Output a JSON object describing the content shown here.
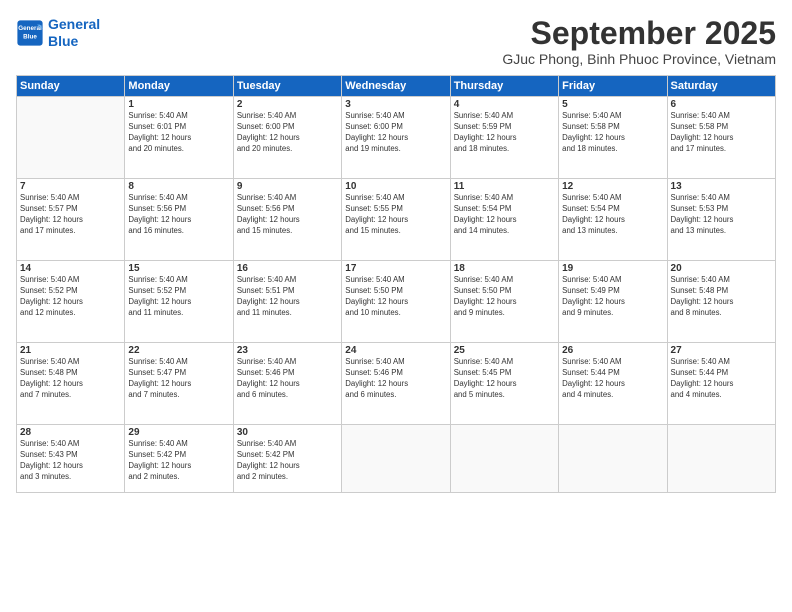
{
  "logo": {
    "line1": "General",
    "line2": "Blue"
  },
  "title": "September 2025",
  "subtitle": "GJuc Phong, Binh Phuoc Province, Vietnam",
  "days_header": [
    "Sunday",
    "Monday",
    "Tuesday",
    "Wednesday",
    "Thursday",
    "Friday",
    "Saturday"
  ],
  "weeks": [
    [
      {
        "day": "",
        "info": ""
      },
      {
        "day": "1",
        "info": "Sunrise: 5:40 AM\nSunset: 6:01 PM\nDaylight: 12 hours\nand 20 minutes."
      },
      {
        "day": "2",
        "info": "Sunrise: 5:40 AM\nSunset: 6:00 PM\nDaylight: 12 hours\nand 20 minutes."
      },
      {
        "day": "3",
        "info": "Sunrise: 5:40 AM\nSunset: 6:00 PM\nDaylight: 12 hours\nand 19 minutes."
      },
      {
        "day": "4",
        "info": "Sunrise: 5:40 AM\nSunset: 5:59 PM\nDaylight: 12 hours\nand 18 minutes."
      },
      {
        "day": "5",
        "info": "Sunrise: 5:40 AM\nSunset: 5:58 PM\nDaylight: 12 hours\nand 18 minutes."
      },
      {
        "day": "6",
        "info": "Sunrise: 5:40 AM\nSunset: 5:58 PM\nDaylight: 12 hours\nand 17 minutes."
      }
    ],
    [
      {
        "day": "7",
        "info": "Sunrise: 5:40 AM\nSunset: 5:57 PM\nDaylight: 12 hours\nand 17 minutes."
      },
      {
        "day": "8",
        "info": "Sunrise: 5:40 AM\nSunset: 5:56 PM\nDaylight: 12 hours\nand 16 minutes."
      },
      {
        "day": "9",
        "info": "Sunrise: 5:40 AM\nSunset: 5:56 PM\nDaylight: 12 hours\nand 15 minutes."
      },
      {
        "day": "10",
        "info": "Sunrise: 5:40 AM\nSunset: 5:55 PM\nDaylight: 12 hours\nand 15 minutes."
      },
      {
        "day": "11",
        "info": "Sunrise: 5:40 AM\nSunset: 5:54 PM\nDaylight: 12 hours\nand 14 minutes."
      },
      {
        "day": "12",
        "info": "Sunrise: 5:40 AM\nSunset: 5:54 PM\nDaylight: 12 hours\nand 13 minutes."
      },
      {
        "day": "13",
        "info": "Sunrise: 5:40 AM\nSunset: 5:53 PM\nDaylight: 12 hours\nand 13 minutes."
      }
    ],
    [
      {
        "day": "14",
        "info": "Sunrise: 5:40 AM\nSunset: 5:52 PM\nDaylight: 12 hours\nand 12 minutes."
      },
      {
        "day": "15",
        "info": "Sunrise: 5:40 AM\nSunset: 5:52 PM\nDaylight: 12 hours\nand 11 minutes."
      },
      {
        "day": "16",
        "info": "Sunrise: 5:40 AM\nSunset: 5:51 PM\nDaylight: 12 hours\nand 11 minutes."
      },
      {
        "day": "17",
        "info": "Sunrise: 5:40 AM\nSunset: 5:50 PM\nDaylight: 12 hours\nand 10 minutes."
      },
      {
        "day": "18",
        "info": "Sunrise: 5:40 AM\nSunset: 5:50 PM\nDaylight: 12 hours\nand 9 minutes."
      },
      {
        "day": "19",
        "info": "Sunrise: 5:40 AM\nSunset: 5:49 PM\nDaylight: 12 hours\nand 9 minutes."
      },
      {
        "day": "20",
        "info": "Sunrise: 5:40 AM\nSunset: 5:48 PM\nDaylight: 12 hours\nand 8 minutes."
      }
    ],
    [
      {
        "day": "21",
        "info": "Sunrise: 5:40 AM\nSunset: 5:48 PM\nDaylight: 12 hours\nand 7 minutes."
      },
      {
        "day": "22",
        "info": "Sunrise: 5:40 AM\nSunset: 5:47 PM\nDaylight: 12 hours\nand 7 minutes."
      },
      {
        "day": "23",
        "info": "Sunrise: 5:40 AM\nSunset: 5:46 PM\nDaylight: 12 hours\nand 6 minutes."
      },
      {
        "day": "24",
        "info": "Sunrise: 5:40 AM\nSunset: 5:46 PM\nDaylight: 12 hours\nand 6 minutes."
      },
      {
        "day": "25",
        "info": "Sunrise: 5:40 AM\nSunset: 5:45 PM\nDaylight: 12 hours\nand 5 minutes."
      },
      {
        "day": "26",
        "info": "Sunrise: 5:40 AM\nSunset: 5:44 PM\nDaylight: 12 hours\nand 4 minutes."
      },
      {
        "day": "27",
        "info": "Sunrise: 5:40 AM\nSunset: 5:44 PM\nDaylight: 12 hours\nand 4 minutes."
      }
    ],
    [
      {
        "day": "28",
        "info": "Sunrise: 5:40 AM\nSunset: 5:43 PM\nDaylight: 12 hours\nand 3 minutes."
      },
      {
        "day": "29",
        "info": "Sunrise: 5:40 AM\nSunset: 5:42 PM\nDaylight: 12 hours\nand 2 minutes."
      },
      {
        "day": "30",
        "info": "Sunrise: 5:40 AM\nSunset: 5:42 PM\nDaylight: 12 hours\nand 2 minutes."
      },
      {
        "day": "",
        "info": ""
      },
      {
        "day": "",
        "info": ""
      },
      {
        "day": "",
        "info": ""
      },
      {
        "day": "",
        "info": ""
      }
    ]
  ]
}
